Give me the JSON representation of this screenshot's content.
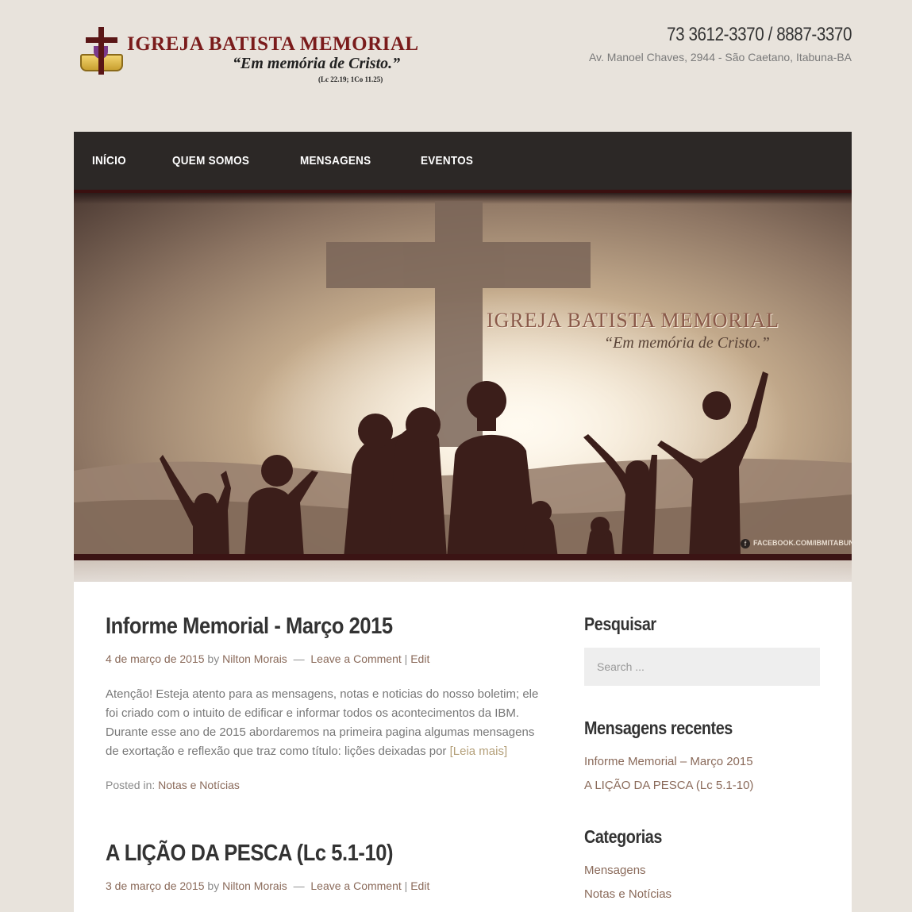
{
  "header": {
    "logo": {
      "title": "IGREJA BATISTA MEMORIAL",
      "tagline": "“Em memória de Cristo.”",
      "reference": "(Lc 22.19; 1Co 11.25)"
    },
    "phone": "73 3612-3370 / 8887-3370",
    "address": "Av. Manoel Chaves, 2944 - São Caetano, Itabuna-BA"
  },
  "nav": {
    "items": [
      {
        "label": "INÍCIO"
      },
      {
        "label": "QUEM SOMOS"
      },
      {
        "label": "MENSAGENS"
      },
      {
        "label": "EVENTOS"
      }
    ]
  },
  "hero": {
    "title": "IGREJA BATISTA MEMORIAL",
    "tagline": "“Em memória de Cristo.”",
    "facebook": "FACEBOOK.COM/IBMITABUNA",
    "facebook_icon": "f"
  },
  "posts": [
    {
      "title": "Informe Memorial - Março 2015",
      "date": "4 de março de 2015",
      "by": "by",
      "author": "Nilton Morais",
      "dash": "—",
      "comment": "Leave a Comment",
      "sep": "|",
      "edit": "Edit",
      "excerpt": "Atenção! Esteja atento para as mensagens, notas e noticias do nosso boletim; ele foi criado com o intuito de edificar e informar todos os acontecimentos da IBM. Durante esse ano de 2015 abordaremos na primeira pagina algumas mensagens de exortação e reflexão que traz como título: lições deixadas por",
      "read_more": "[Leia mais]",
      "posted_in": "Posted in:",
      "category": "Notas e Notícias"
    },
    {
      "title": "A LIÇÃO DA PESCA (Lc 5.1-10)",
      "date": "3 de março de 2015",
      "by": "by",
      "author": "Nilton Morais",
      "dash": "—",
      "comment": "Leave a Comment",
      "sep": "|",
      "edit": "Edit"
    }
  ],
  "sidebar": {
    "search": {
      "title": "Pesquisar",
      "placeholder": "Search ..."
    },
    "recent": {
      "title": "Mensagens recentes",
      "items": [
        "Informe Memorial – Março 2015",
        "A LIÇÃO DA PESCA (Lc 5.1-10)"
      ]
    },
    "categories": {
      "title": "Categorias",
      "items": [
        "Mensagens",
        "Notas e Notícias"
      ]
    }
  }
}
